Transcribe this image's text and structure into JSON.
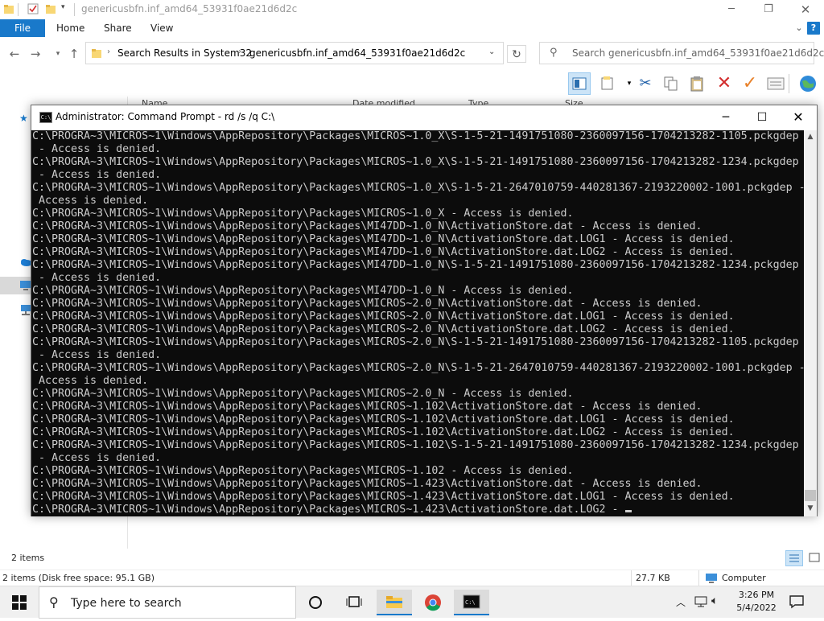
{
  "explorer": {
    "title": "genericusbfn.inf_amd64_53931f0ae21d6d2c",
    "ribbon_tabs": {
      "file": "File",
      "home": "Home",
      "share": "Share",
      "view": "View"
    },
    "breadcrumb": [
      "Search Results in System32",
      "genericusbfn.inf_amd64_53931f0ae21d6d2c"
    ],
    "search_placeholder": "Search genericusbfn.inf_amd64_53931f0ae21d6d2c",
    "columns": [
      "Name",
      "Date modified",
      "Type",
      "Size"
    ],
    "items_count": "2 items",
    "status": {
      "details": "2 items (Disk free space: 95.1 GB)",
      "size": "27.7 KB",
      "location": "Computer"
    }
  },
  "cmd": {
    "title": "Administrator: Command Prompt - rd  /s /q C:\\",
    "lines": [
      "C:\\PROGRA~3\\MICROS~1\\Windows\\AppRepository\\Packages\\MICROS~1.0_X\\S-1-5-21-1491751080-2360097156-1704213282-1105.pckgdep",
      " - Access is denied.",
      "C:\\PROGRA~3\\MICROS~1\\Windows\\AppRepository\\Packages\\MICROS~1.0_X\\S-1-5-21-1491751080-2360097156-1704213282-1234.pckgdep",
      " - Access is denied.",
      "C:\\PROGRA~3\\MICROS~1\\Windows\\AppRepository\\Packages\\MICROS~1.0_X\\S-1-5-21-2647010759-440281367-2193220002-1001.pckgdep -",
      " Access is denied.",
      "C:\\PROGRA~3\\MICROS~1\\Windows\\AppRepository\\Packages\\MICROS~1.0_X - Access is denied.",
      "C:\\PROGRA~3\\MICROS~1\\Windows\\AppRepository\\Packages\\MI47DD~1.0_N\\ActivationStore.dat - Access is denied.",
      "C:\\PROGRA~3\\MICROS~1\\Windows\\AppRepository\\Packages\\MI47DD~1.0_N\\ActivationStore.dat.LOG1 - Access is denied.",
      "C:\\PROGRA~3\\MICROS~1\\Windows\\AppRepository\\Packages\\MI47DD~1.0_N\\ActivationStore.dat.LOG2 - Access is denied.",
      "C:\\PROGRA~3\\MICROS~1\\Windows\\AppRepository\\Packages\\MI47DD~1.0_N\\S-1-5-21-1491751080-2360097156-1704213282-1234.pckgdep",
      " - Access is denied.",
      "C:\\PROGRA~3\\MICROS~1\\Windows\\AppRepository\\Packages\\MI47DD~1.0_N - Access is denied.",
      "C:\\PROGRA~3\\MICROS~1\\Windows\\AppRepository\\Packages\\MICROS~2.0_N\\ActivationStore.dat - Access is denied.",
      "C:\\PROGRA~3\\MICROS~1\\Windows\\AppRepository\\Packages\\MICROS~2.0_N\\ActivationStore.dat.LOG1 - Access is denied.",
      "C:\\PROGRA~3\\MICROS~1\\Windows\\AppRepository\\Packages\\MICROS~2.0_N\\ActivationStore.dat.LOG2 - Access is denied.",
      "C:\\PROGRA~3\\MICROS~1\\Windows\\AppRepository\\Packages\\MICROS~2.0_N\\S-1-5-21-1491751080-2360097156-1704213282-1105.pckgdep",
      " - Access is denied.",
      "C:\\PROGRA~3\\MICROS~1\\Windows\\AppRepository\\Packages\\MICROS~2.0_N\\S-1-5-21-2647010759-440281367-2193220002-1001.pckgdep -",
      " Access is denied.",
      "C:\\PROGRA~3\\MICROS~1\\Windows\\AppRepository\\Packages\\MICROS~2.0_N - Access is denied.",
      "C:\\PROGRA~3\\MICROS~1\\Windows\\AppRepository\\Packages\\MICROS~1.102\\ActivationStore.dat - Access is denied.",
      "C:\\PROGRA~3\\MICROS~1\\Windows\\AppRepository\\Packages\\MICROS~1.102\\ActivationStore.dat.LOG1 - Access is denied.",
      "C:\\PROGRA~3\\MICROS~1\\Windows\\AppRepository\\Packages\\MICROS~1.102\\ActivationStore.dat.LOG2 - Access is denied.",
      "C:\\PROGRA~3\\MICROS~1\\Windows\\AppRepository\\Packages\\MICROS~1.102\\S-1-5-21-1491751080-2360097156-1704213282-1234.pckgdep",
      " - Access is denied.",
      "C:\\PROGRA~3\\MICROS~1\\Windows\\AppRepository\\Packages\\MICROS~1.102 - Access is denied.",
      "C:\\PROGRA~3\\MICROS~1\\Windows\\AppRepository\\Packages\\MICROS~1.423\\ActivationStore.dat - Access is denied.",
      "C:\\PROGRA~3\\MICROS~1\\Windows\\AppRepository\\Packages\\MICROS~1.423\\ActivationStore.dat.LOG1 - Access is denied.",
      "C:\\PROGRA~3\\MICROS~1\\Windows\\AppRepository\\Packages\\MICROS~1.423\\ActivationStore.dat.LOG2 -"
    ]
  },
  "taskbar": {
    "search_placeholder": "Type here to search",
    "time": "3:26 PM",
    "date": "5/4/2022"
  },
  "colors": {
    "accent": "#1979ca",
    "console_bg": "#0c0c0c",
    "console_text": "#cccccc"
  }
}
